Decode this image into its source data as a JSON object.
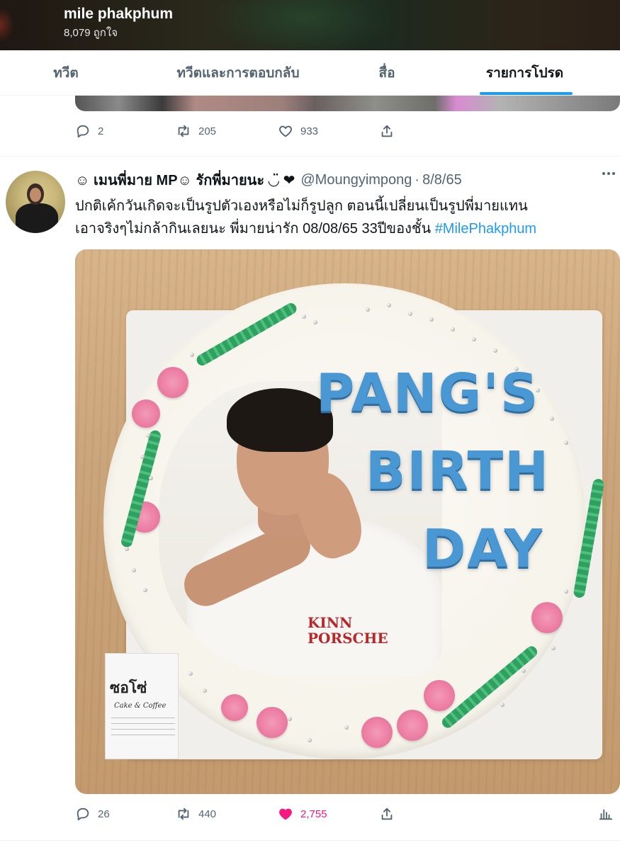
{
  "profile": {
    "name": "mile phakphum",
    "likes_count": "8,079 ถูกใจ"
  },
  "tabs": [
    {
      "label": "ทวีต",
      "active": false
    },
    {
      "label": "ทวีตและการตอบกลับ",
      "active": false
    },
    {
      "label": "สื่อ",
      "active": false
    },
    {
      "label": "รายการโปรด",
      "active": true
    }
  ],
  "colors": {
    "accent": "#1d9bf0",
    "like": "#f91880",
    "muted": "#536471",
    "text": "#0f1419"
  },
  "previous_tweet": {
    "replies": "2",
    "retweets": "205",
    "likes": "933"
  },
  "tweet": {
    "display_name": "☺ เมนพี่มาย MP☺ รักพี่มายนะ ◡̈ ❤",
    "handle": "@Moungyimpong",
    "separator": "·",
    "date": "8/8/65",
    "text_line1": "ปกติเค้กวันเกิดจะเป็นรูปตัวเองหรือไม่ก็รูปลูก ตอนนี้เปลี่ยนเป็นรูปพี่มายแทน",
    "text_line2": "เอาจริงๆไม่กล้ากินเลยนะ พี่มายน่ารัก 08/08/65 33ปีของชั้น ",
    "hashtag": "#MilePhakphum",
    "media": {
      "cake_line1": "PANG'S",
      "cake_line2": "BIRTH",
      "cake_line3": "DAY",
      "shirt_logo_line1": "KINN",
      "shirt_logo_line2": "PORSCHE",
      "shop_name": "ซอโซ่",
      "shop_sub": "Cake & Coffee"
    },
    "replies": "26",
    "retweets": "440",
    "likes": "2,755",
    "liked": true
  },
  "icons": [
    "reply-icon",
    "retweet-icon",
    "heart-icon",
    "share-icon",
    "analytics-icon",
    "more-icon"
  ]
}
